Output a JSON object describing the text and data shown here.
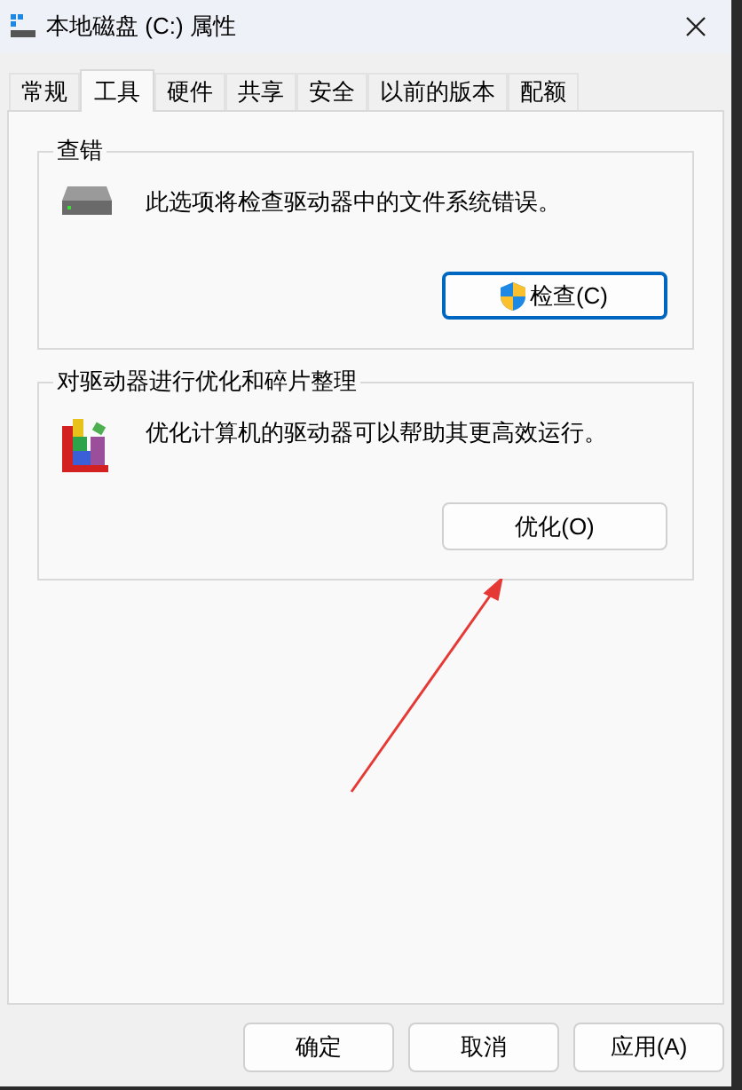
{
  "window": {
    "title": "本地磁盘 (C:) 属性"
  },
  "tabs": [
    {
      "label": "常规",
      "selected": false
    },
    {
      "label": "工具",
      "selected": true
    },
    {
      "label": "硬件",
      "selected": false
    },
    {
      "label": "共享",
      "selected": false
    },
    {
      "label": "安全",
      "selected": false
    },
    {
      "label": "以前的版本",
      "selected": false
    },
    {
      "label": "配额",
      "selected": false
    }
  ],
  "groups": [
    {
      "kind": "check",
      "title": "查错",
      "description": "此选项将检查驱动器中的文件系统错误。",
      "button": "检查(C)",
      "default": true
    },
    {
      "kind": "optimize",
      "title": "对驱动器进行优化和碎片整理",
      "description": "优化计算机的驱动器可以帮助其更高效运行。",
      "button": "优化(O)",
      "default": false
    }
  ],
  "buttons": [
    "确定",
    "取消",
    "应用(A)"
  ]
}
